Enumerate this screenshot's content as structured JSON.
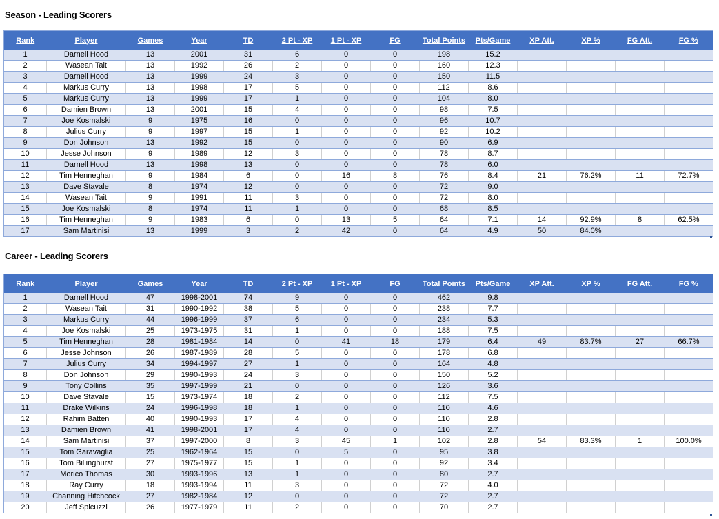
{
  "season": {
    "title": "Season - Leading Scorers",
    "columns": [
      "Rank",
      "Player",
      "Games",
      "Year",
      "TD",
      "2 Pt - XP",
      "1 Pt - XP",
      "FG",
      "Total Points",
      "Pts/Game",
      "XP Att.",
      "XP %",
      "FG Att.",
      "FG %"
    ],
    "rows": [
      [
        "1",
        "Darnell Hood",
        "13",
        "2001",
        "31",
        "6",
        "0",
        "0",
        "198",
        "15.2",
        "",
        "",
        "",
        ""
      ],
      [
        "2",
        "Wasean Tait",
        "13",
        "1992",
        "26",
        "2",
        "0",
        "0",
        "160",
        "12.3",
        "",
        "",
        "",
        ""
      ],
      [
        "3",
        "Darnell Hood",
        "13",
        "1999",
        "24",
        "3",
        "0",
        "0",
        "150",
        "11.5",
        "",
        "",
        "",
        ""
      ],
      [
        "4",
        "Markus Curry",
        "13",
        "1998",
        "17",
        "5",
        "0",
        "0",
        "112",
        "8.6",
        "",
        "",
        "",
        ""
      ],
      [
        "5",
        "Markus Curry",
        "13",
        "1999",
        "17",
        "1",
        "0",
        "0",
        "104",
        "8.0",
        "",
        "",
        "",
        ""
      ],
      [
        "6",
        "Damien Brown",
        "13",
        "2001",
        "15",
        "4",
        "0",
        "0",
        "98",
        "7.5",
        "",
        "",
        "",
        ""
      ],
      [
        "7",
        "Joe Kosmalski",
        "9",
        "1975",
        "16",
        "0",
        "0",
        "0",
        "96",
        "10.7",
        "",
        "",
        "",
        ""
      ],
      [
        "8",
        "Julius Curry",
        "9",
        "1997",
        "15",
        "1",
        "0",
        "0",
        "92",
        "10.2",
        "",
        "",
        "",
        ""
      ],
      [
        "9",
        "Don Johnson",
        "13",
        "1992",
        "15",
        "0",
        "0",
        "0",
        "90",
        "6.9",
        "",
        "",
        "",
        ""
      ],
      [
        "10",
        "Jesse Johnson",
        "9",
        "1989",
        "12",
        "3",
        "0",
        "0",
        "78",
        "8.7",
        "",
        "",
        "",
        ""
      ],
      [
        "11",
        "Darnell Hood",
        "13",
        "1998",
        "13",
        "0",
        "0",
        "0",
        "78",
        "6.0",
        "",
        "",
        "",
        ""
      ],
      [
        "12",
        "Tim Henneghan",
        "9",
        "1984",
        "6",
        "0",
        "16",
        "8",
        "76",
        "8.4",
        "21",
        "76.2%",
        "11",
        "72.7%"
      ],
      [
        "13",
        "Dave Stavale",
        "8",
        "1974",
        "12",
        "0",
        "0",
        "0",
        "72",
        "9.0",
        "",
        "",
        "",
        ""
      ],
      [
        "14",
        "Wasean Tait",
        "9",
        "1991",
        "11",
        "3",
        "0",
        "0",
        "72",
        "8.0",
        "",
        "",
        "",
        ""
      ],
      [
        "15",
        "Joe Kosmalski",
        "8",
        "1974",
        "11",
        "1",
        "0",
        "0",
        "68",
        "8.5",
        "",
        "",
        "",
        ""
      ],
      [
        "16",
        "Tim Henneghan",
        "9",
        "1983",
        "6",
        "0",
        "13",
        "5",
        "64",
        "7.1",
        "14",
        "92.9%",
        "8",
        "62.5%"
      ],
      [
        "17",
        "Sam Martinisi",
        "13",
        "1999",
        "3",
        "2",
        "42",
        "0",
        "64",
        "4.9",
        "50",
        "84.0%",
        "",
        ""
      ]
    ]
  },
  "career": {
    "title": "Career - Leading Scorers",
    "columns": [
      "Rank",
      "Player",
      "Games",
      "Year",
      "TD",
      "2 Pt - XP",
      "1 Pt - XP",
      "FG",
      "Total Points",
      "Pts/Game",
      "XP Att.",
      "XP %",
      "FG Att.",
      "FG %"
    ],
    "rows": [
      [
        "1",
        "Darnell Hood",
        "47",
        "1998-2001",
        "74",
        "9",
        "0",
        "0",
        "462",
        "9.8",
        "",
        "",
        "",
        ""
      ],
      [
        "2",
        "Wasean Tait",
        "31",
        "1990-1992",
        "38",
        "5",
        "0",
        "0",
        "238",
        "7.7",
        "",
        "",
        "",
        ""
      ],
      [
        "3",
        "Markus Curry",
        "44",
        "1996-1999",
        "37",
        "6",
        "0",
        "0",
        "234",
        "5.3",
        "",
        "",
        "",
        ""
      ],
      [
        "4",
        "Joe Kosmalski",
        "25",
        "1973-1975",
        "31",
        "1",
        "0",
        "0",
        "188",
        "7.5",
        "",
        "",
        "",
        ""
      ],
      [
        "5",
        "Tim Henneghan",
        "28",
        "1981-1984",
        "14",
        "0",
        "41",
        "18",
        "179",
        "6.4",
        "49",
        "83.7%",
        "27",
        "66.7%"
      ],
      [
        "6",
        "Jesse Johnson",
        "26",
        "1987-1989",
        "28",
        "5",
        "0",
        "0",
        "178",
        "6.8",
        "",
        "",
        "",
        ""
      ],
      [
        "7",
        "Julius Curry",
        "34",
        "1994-1997",
        "27",
        "1",
        "0",
        "0",
        "164",
        "4.8",
        "",
        "",
        "",
        ""
      ],
      [
        "8",
        "Don Johnson",
        "29",
        "1990-1993",
        "24",
        "3",
        "0",
        "0",
        "150",
        "5.2",
        "",
        "",
        "",
        ""
      ],
      [
        "9",
        "Tony Collins",
        "35",
        "1997-1999",
        "21",
        "0",
        "0",
        "0",
        "126",
        "3.6",
        "",
        "",
        "",
        ""
      ],
      [
        "10",
        "Dave Stavale",
        "15",
        "1973-1974",
        "18",
        "2",
        "0",
        "0",
        "112",
        "7.5",
        "",
        "",
        "",
        ""
      ],
      [
        "11",
        "Drake Wilkins",
        "24",
        "1996-1998",
        "18",
        "1",
        "0",
        "0",
        "110",
        "4.6",
        "",
        "",
        "",
        ""
      ],
      [
        "12",
        "Rahim Batten",
        "40",
        "1990-1993",
        "17",
        "4",
        "0",
        "0",
        "110",
        "2.8",
        "",
        "",
        "",
        ""
      ],
      [
        "13",
        "Damien Brown",
        "41",
        "1998-2001",
        "17",
        "4",
        "0",
        "0",
        "110",
        "2.7",
        "",
        "",
        "",
        ""
      ],
      [
        "14",
        "Sam Martinisi",
        "37",
        "1997-2000",
        "8",
        "3",
        "45",
        "1",
        "102",
        "2.8",
        "54",
        "83.3%",
        "1",
        "100.0%"
      ],
      [
        "15",
        "Tom Garavaglia",
        "25",
        "1962-1964",
        "15",
        "0",
        "5",
        "0",
        "95",
        "3.8",
        "",
        "",
        "",
        ""
      ],
      [
        "16",
        "Tom Billinghurst",
        "27",
        "1975-1977",
        "15",
        "1",
        "0",
        "0",
        "92",
        "3.4",
        "",
        "",
        "",
        ""
      ],
      [
        "17",
        "Morico Thomas",
        "30",
        "1993-1996",
        "13",
        "1",
        "0",
        "0",
        "80",
        "2.7",
        "",
        "",
        "",
        ""
      ],
      [
        "18",
        "Ray Curry",
        "18",
        "1993-1994",
        "11",
        "3",
        "0",
        "0",
        "72",
        "4.0",
        "",
        "",
        "",
        ""
      ],
      [
        "19",
        "Channing Hitchcock",
        "27",
        "1982-1984",
        "12",
        "0",
        "0",
        "0",
        "72",
        "2.7",
        "",
        "",
        "",
        ""
      ],
      [
        "20",
        "Jeff Spicuzzi",
        "26",
        "1977-1979",
        "11",
        "2",
        "0",
        "0",
        "70",
        "2.7",
        "",
        "",
        "",
        ""
      ]
    ]
  },
  "colors": {
    "header_bg": "#4472c4",
    "band_bg": "#d9e1f2",
    "border": "#8ea9db"
  }
}
